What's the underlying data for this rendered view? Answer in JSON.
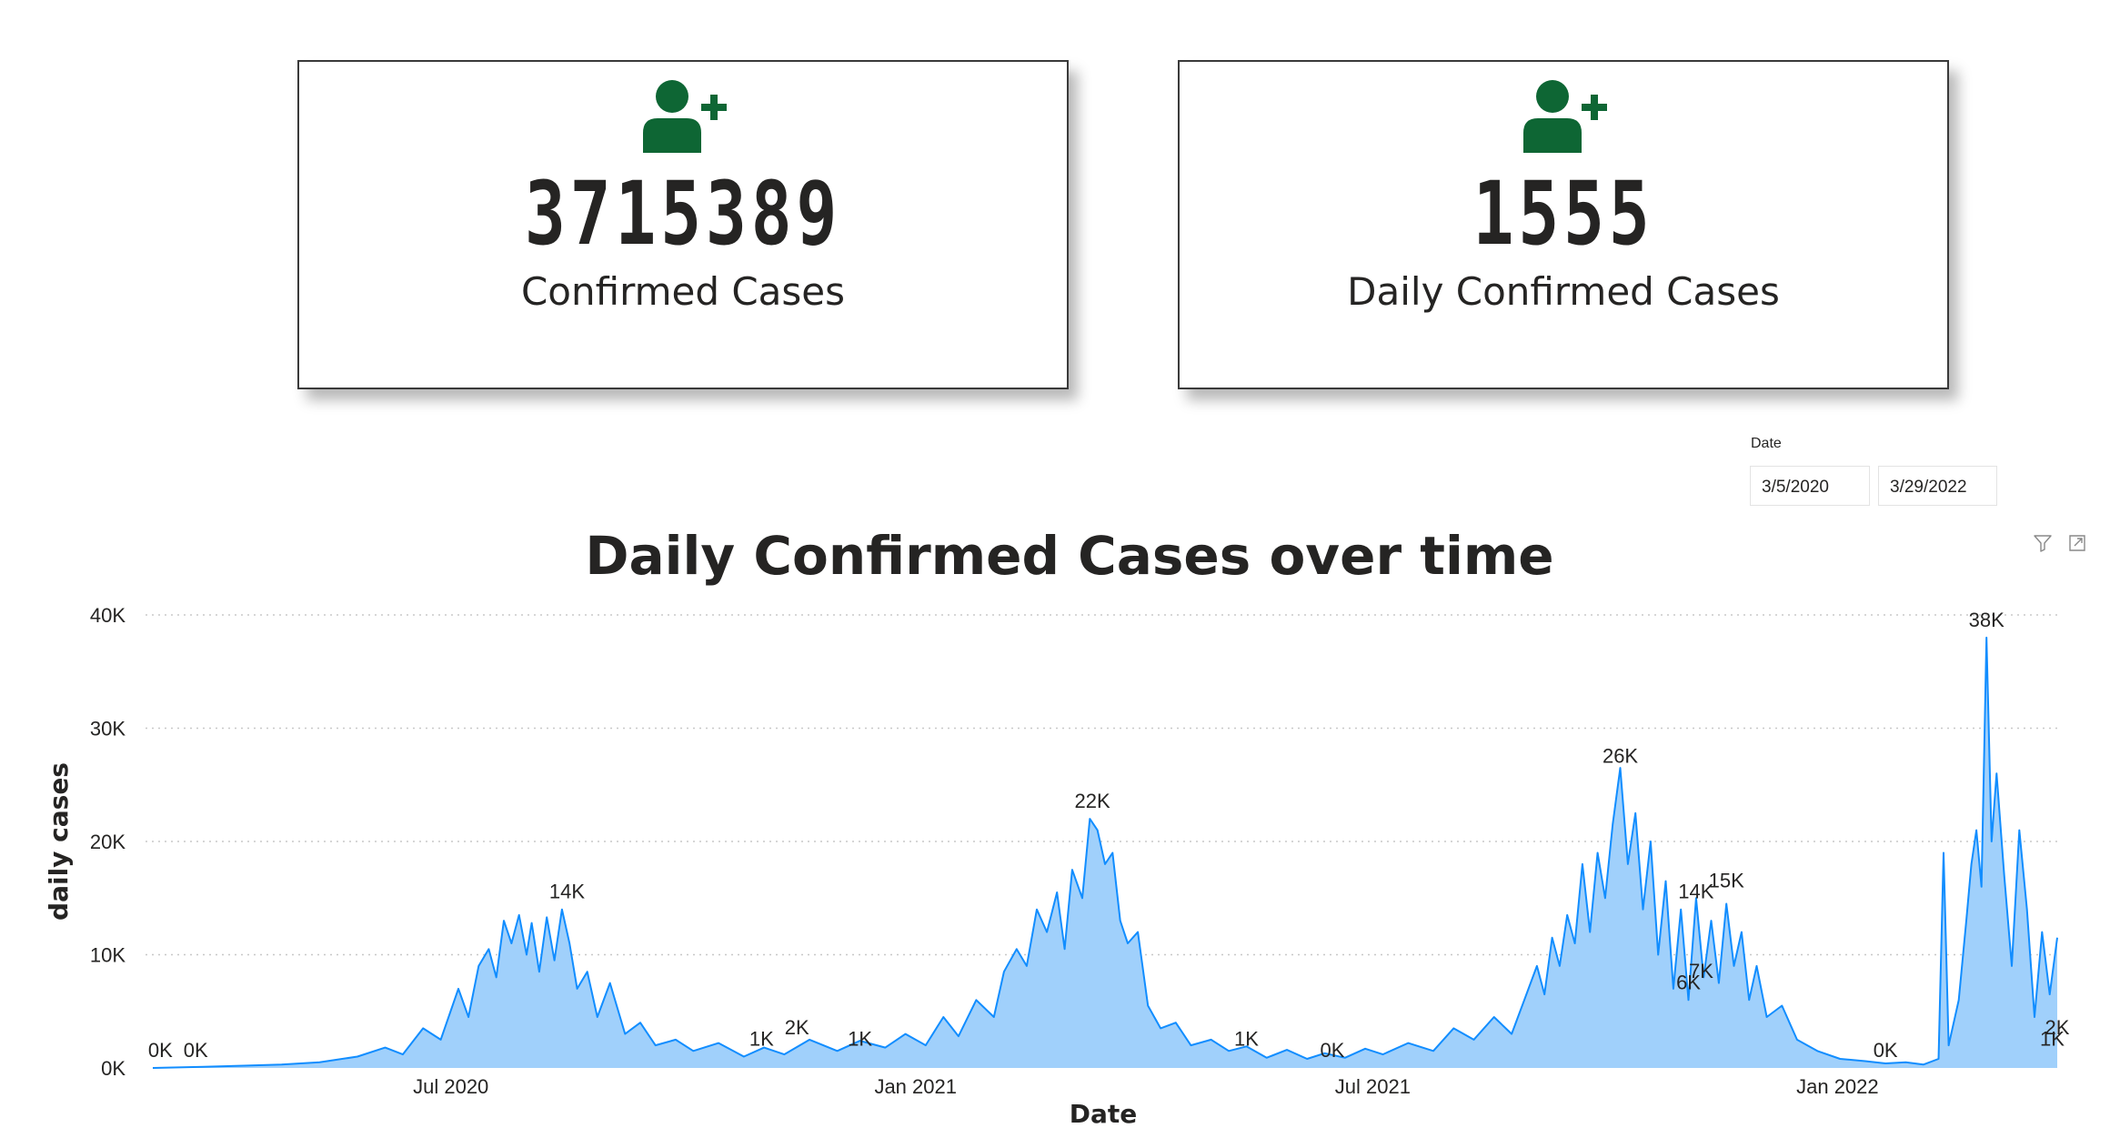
{
  "cards": [
    {
      "value": "3715389",
      "label": "Confirmed Cases",
      "icon": "add-user-icon"
    },
    {
      "value": "1555",
      "label": "Daily Confirmed Cases",
      "icon": "add-user-icon"
    }
  ],
  "accent_color": "#0E6634",
  "date_slicer": {
    "title": "Date",
    "start": "3/5/2020",
    "end": "3/29/2022"
  },
  "header_icons": [
    "filter-icon",
    "focus-mode-icon"
  ],
  "chart_data": {
    "type": "area",
    "title": "Daily Confirmed Cases over time",
    "xlabel": "Date",
    "ylabel": "daily cases",
    "ylim": [
      0,
      40000
    ],
    "yticks": [
      "0K",
      "10K",
      "20K",
      "30K",
      "40K"
    ],
    "xticks": [
      {
        "date": "2020-07-01",
        "label": "Jul 2020"
      },
      {
        "date": "2021-01-01",
        "label": "Jan 2021"
      },
      {
        "date": "2021-07-01",
        "label": "Jul 2021"
      },
      {
        "date": "2022-01-01",
        "label": "Jan 2022"
      }
    ],
    "x_range": [
      "2020-03-05",
      "2022-03-29"
    ],
    "grid": true,
    "line_color": "#118DFF",
    "fill_color": "#A0D0FB",
    "series": [
      {
        "points": [
          [
            "2020-03-05",
            0
          ],
          [
            "2020-03-25",
            100
          ],
          [
            "2020-04-10",
            200
          ],
          [
            "2020-04-25",
            300
          ],
          [
            "2020-05-10",
            500
          ],
          [
            "2020-05-25",
            1000
          ],
          [
            "2020-06-05",
            1800
          ],
          [
            "2020-06-12",
            1200
          ],
          [
            "2020-06-20",
            3500
          ],
          [
            "2020-06-27",
            2500
          ],
          [
            "2020-07-04",
            7000
          ],
          [
            "2020-07-08",
            4500
          ],
          [
            "2020-07-12",
            9000
          ],
          [
            "2020-07-16",
            10500
          ],
          [
            "2020-07-19",
            8000
          ],
          [
            "2020-07-22",
            13000
          ],
          [
            "2020-07-25",
            11000
          ],
          [
            "2020-07-28",
            13500
          ],
          [
            "2020-07-31",
            10000
          ],
          [
            "2020-08-02",
            12800
          ],
          [
            "2020-08-05",
            8500
          ],
          [
            "2020-08-08",
            13300
          ],
          [
            "2020-08-11",
            9500
          ],
          [
            "2020-08-14",
            14000
          ],
          [
            "2020-08-17",
            11000
          ],
          [
            "2020-08-20",
            7000
          ],
          [
            "2020-08-24",
            8500
          ],
          [
            "2020-08-28",
            4500
          ],
          [
            "2020-09-02",
            7500
          ],
          [
            "2020-09-08",
            3000
          ],
          [
            "2020-09-14",
            4000
          ],
          [
            "2020-09-20",
            2000
          ],
          [
            "2020-09-28",
            2500
          ],
          [
            "2020-10-05",
            1500
          ],
          [
            "2020-10-15",
            2200
          ],
          [
            "2020-10-25",
            1000
          ],
          [
            "2020-11-02",
            1800
          ],
          [
            "2020-11-10",
            1200
          ],
          [
            "2020-11-20",
            2500
          ],
          [
            "2020-12-01",
            1500
          ],
          [
            "2020-12-10",
            2400
          ],
          [
            "2020-12-20",
            1800
          ],
          [
            "2020-12-28",
            3000
          ],
          [
            "2021-01-05",
            2000
          ],
          [
            "2021-01-12",
            4500
          ],
          [
            "2021-01-18",
            2800
          ],
          [
            "2021-01-25",
            6000
          ],
          [
            "2021-02-01",
            4500
          ],
          [
            "2021-02-05",
            8500
          ],
          [
            "2021-02-10",
            10500
          ],
          [
            "2021-02-14",
            9000
          ],
          [
            "2021-02-18",
            14000
          ],
          [
            "2021-02-22",
            12000
          ],
          [
            "2021-02-26",
            15500
          ],
          [
            "2021-03-01",
            10500
          ],
          [
            "2021-03-04",
            17500
          ],
          [
            "2021-03-08",
            15000
          ],
          [
            "2021-03-11",
            22000
          ],
          [
            "2021-03-14",
            21000
          ],
          [
            "2021-03-17",
            18000
          ],
          [
            "2021-03-20",
            19000
          ],
          [
            "2021-03-23",
            13000
          ],
          [
            "2021-03-26",
            11000
          ],
          [
            "2021-03-30",
            12000
          ],
          [
            "2021-04-03",
            5500
          ],
          [
            "2021-04-08",
            3500
          ],
          [
            "2021-04-14",
            4000
          ],
          [
            "2021-04-20",
            2000
          ],
          [
            "2021-04-28",
            2500
          ],
          [
            "2021-05-05",
            1500
          ],
          [
            "2021-05-12",
            1900
          ],
          [
            "2021-05-20",
            900
          ],
          [
            "2021-05-28",
            1600
          ],
          [
            "2021-06-05",
            800
          ],
          [
            "2021-06-12",
            1300
          ],
          [
            "2021-06-20",
            900
          ],
          [
            "2021-06-28",
            1700
          ],
          [
            "2021-07-05",
            1200
          ],
          [
            "2021-07-15",
            2200
          ],
          [
            "2021-07-25",
            1500
          ],
          [
            "2021-08-02",
            3500
          ],
          [
            "2021-08-10",
            2500
          ],
          [
            "2021-08-18",
            4500
          ],
          [
            "2021-08-25",
            3000
          ],
          [
            "2021-08-30",
            6000
          ],
          [
            "2021-09-04",
            9000
          ],
          [
            "2021-09-07",
            6500
          ],
          [
            "2021-09-10",
            11500
          ],
          [
            "2021-09-13",
            9000
          ],
          [
            "2021-09-16",
            13500
          ],
          [
            "2021-09-19",
            11000
          ],
          [
            "2021-09-22",
            18000
          ],
          [
            "2021-09-25",
            12000
          ],
          [
            "2021-09-28",
            19000
          ],
          [
            "2021-10-01",
            15000
          ],
          [
            "2021-10-04",
            21500
          ],
          [
            "2021-10-07",
            26500
          ],
          [
            "2021-10-10",
            18000
          ],
          [
            "2021-10-13",
            22500
          ],
          [
            "2021-10-16",
            14000
          ],
          [
            "2021-10-19",
            20000
          ],
          [
            "2021-10-22",
            10000
          ],
          [
            "2021-10-25",
            16500
          ],
          [
            "2021-10-28",
            7000
          ],
          [
            "2021-10-31",
            14000
          ],
          [
            "2021-11-03",
            6000
          ],
          [
            "2021-11-06",
            15000
          ],
          [
            "2021-11-09",
            8000
          ],
          [
            "2021-11-12",
            13000
          ],
          [
            "2021-11-15",
            7500
          ],
          [
            "2021-11-18",
            14500
          ],
          [
            "2021-11-21",
            9000
          ],
          [
            "2021-11-24",
            12000
          ],
          [
            "2021-11-27",
            6000
          ],
          [
            "2021-11-30",
            9000
          ],
          [
            "2021-12-04",
            4500
          ],
          [
            "2021-12-10",
            5500
          ],
          [
            "2021-12-16",
            2500
          ],
          [
            "2021-12-24",
            1500
          ],
          [
            "2022-01-02",
            800
          ],
          [
            "2022-01-12",
            600
          ],
          [
            "2022-01-20",
            400
          ],
          [
            "2022-01-28",
            500
          ],
          [
            "2022-02-04",
            300
          ],
          [
            "2022-02-10",
            800
          ],
          [
            "2022-02-12",
            19000
          ],
          [
            "2022-02-14",
            2000
          ],
          [
            "2022-02-18",
            6000
          ],
          [
            "2022-02-21",
            13000
          ],
          [
            "2022-02-23",
            18000
          ],
          [
            "2022-02-25",
            21000
          ],
          [
            "2022-02-27",
            16000
          ],
          [
            "2022-03-01",
            38000
          ],
          [
            "2022-03-03",
            20000
          ],
          [
            "2022-03-05",
            26000
          ],
          [
            "2022-03-08",
            17000
          ],
          [
            "2022-03-11",
            9000
          ],
          [
            "2022-03-14",
            21000
          ],
          [
            "2022-03-17",
            14000
          ],
          [
            "2022-03-20",
            4500
          ],
          [
            "2022-03-23",
            12000
          ],
          [
            "2022-03-26",
            6500
          ],
          [
            "2022-03-29",
            11500
          ]
        ]
      }
    ],
    "data_labels": [
      {
        "date": "2020-03-08",
        "value": 0,
        "text": "0K"
      },
      {
        "date": "2020-03-22",
        "value": 0,
        "text": "0K"
      },
      {
        "date": "2020-08-16",
        "value": 14000,
        "text": "14K"
      },
      {
        "date": "2020-11-01",
        "value": 1000,
        "text": "1K"
      },
      {
        "date": "2020-11-15",
        "value": 2000,
        "text": "2K"
      },
      {
        "date": "2020-12-10",
        "value": 1000,
        "text": "1K"
      },
      {
        "date": "2021-03-12",
        "value": 22000,
        "text": "22K"
      },
      {
        "date": "2021-05-12",
        "value": 1000,
        "text": "1K"
      },
      {
        "date": "2021-06-15",
        "value": 0,
        "text": "0K"
      },
      {
        "date": "2021-10-07",
        "value": 26000,
        "text": "26K"
      },
      {
        "date": "2021-11-03",
        "value": 6000,
        "text": "6K"
      },
      {
        "date": "2021-11-06",
        "value": 14000,
        "text": "14K"
      },
      {
        "date": "2021-11-08",
        "value": 7000,
        "text": "7K"
      },
      {
        "date": "2021-11-18",
        "value": 15000,
        "text": "15K"
      },
      {
        "date": "2022-01-20",
        "value": 0,
        "text": "0K"
      },
      {
        "date": "2022-03-01",
        "value": 38000,
        "text": "38K"
      },
      {
        "date": "2022-03-27",
        "value": 1000,
        "text": "1K"
      },
      {
        "date": "2022-03-29",
        "value": 2000,
        "text": "2K"
      }
    ]
  }
}
